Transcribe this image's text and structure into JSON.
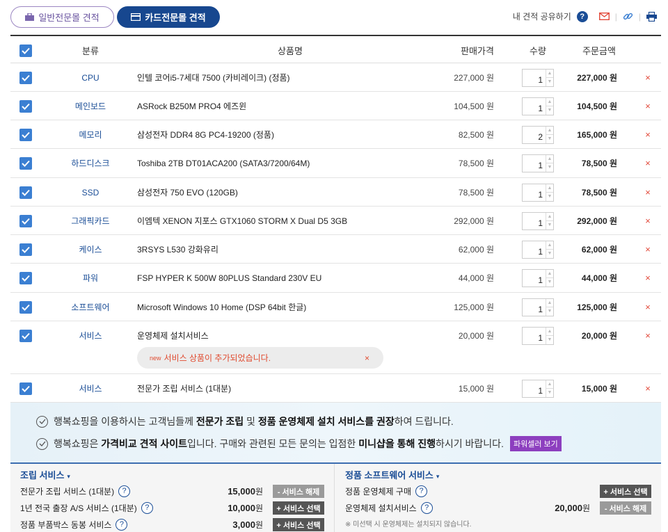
{
  "tabs": {
    "general": "일반전문몰 견적",
    "card": "카드전문몰 견적"
  },
  "share": {
    "label": "내 견적 공유하기",
    "help": "?"
  },
  "table": {
    "headers": {
      "category": "분류",
      "name": "상품명",
      "price": "판매가격",
      "qty": "수량",
      "total": "주문금액"
    },
    "rows": [
      {
        "category": "CPU",
        "name": "인텔 코어i5-7세대 7500 (카비레이크) (정품)",
        "price": "227,000 원",
        "qty": "1",
        "total": "227,000 원"
      },
      {
        "category": "메인보드",
        "name": "ASRock B250M PRO4 에즈윈",
        "price": "104,500 원",
        "qty": "1",
        "total": "104,500 원"
      },
      {
        "category": "메모리",
        "name": "삼성전자 DDR4 8G PC4-19200 (정품)",
        "price": "82,500 원",
        "qty": "2",
        "total": "165,000 원"
      },
      {
        "category": "하드디스크",
        "name": "Toshiba 2TB DT01ACA200 (SATA3/7200/64M)",
        "price": "78,500 원",
        "qty": "1",
        "total": "78,500 원"
      },
      {
        "category": "SSD",
        "name": "삼성전자 750 EVO (120GB)",
        "price": "78,500 원",
        "qty": "1",
        "total": "78,500 원"
      },
      {
        "category": "그래픽카드",
        "name": "이엠텍 XENON 지포스 GTX1060 STORM X Dual D5 3GB",
        "price": "292,000 원",
        "qty": "1",
        "total": "292,000 원"
      },
      {
        "category": "케이스",
        "name": "3RSYS L530 강화유리",
        "price": "62,000 원",
        "qty": "1",
        "total": "62,000 원"
      },
      {
        "category": "파워",
        "name": "FSP HYPER K 500W 80PLUS Standard 230V EU",
        "price": "44,000 원",
        "qty": "1",
        "total": "44,000 원"
      },
      {
        "category": "소프트웨어",
        "name": "Microsoft Windows 10 Home (DSP 64bit 한글)",
        "price": "125,000 원",
        "qty": "1",
        "total": "125,000 원"
      },
      {
        "category": "서비스",
        "name": "운영체제 설치서비스",
        "price": "20,000 원",
        "qty": "1",
        "total": "20,000 원"
      },
      {
        "category": "서비스",
        "name": "전문가 조립 서비스 (1대분)",
        "price": "15,000 원",
        "qty": "1",
        "total": "15,000 원"
      }
    ],
    "delete_symbol": "×",
    "notice": {
      "badge": "new",
      "text": "서비스 상품이 추가되었습니다.",
      "close": "×"
    }
  },
  "info": {
    "line1": {
      "a": "행복쇼핑을 이용하시는 고객님들께 ",
      "b": "전문가 조립",
      "c": " 및 ",
      "d": "정품 운영체제 설치 서비스를 권장",
      "e": "하여 드립니다."
    },
    "line2": {
      "a": "행복쇼핑은 ",
      "b": "가격비교 견적 사이트",
      "c": "입니다. 구매와 관련된 모든 문의는 입점한 ",
      "d": "미니샵을 통해 진행",
      "e": "하시기 바랍니다.",
      "button": "파워셀러 보기"
    }
  },
  "services": {
    "assembly": {
      "title": "조립 서비스",
      "items": [
        {
          "label": "전문가 조립 서비스 (1대분)",
          "price": "15,000",
          "unit": "원",
          "button": "- 서비스 해제",
          "selected": true
        },
        {
          "label": "1년 전국 출장 A/S 서비스 (1대분)",
          "price": "10,000",
          "unit": "원",
          "button": "+ 서비스 선택",
          "selected": false
        },
        {
          "label": "정품 부품박스 동봉 서비스",
          "price": "3,000",
          "unit": "원",
          "button": "+ 서비스 선택",
          "selected": false
        }
      ]
    },
    "software": {
      "title": "정품 소프트웨어 서비스",
      "items": [
        {
          "label": "정품 운영체제 구매",
          "button": "+ 서비스 선택",
          "selected": false
        },
        {
          "label": "운영체제 설치서비스",
          "price": "20,000",
          "unit": "원",
          "button": "- 서비스 해제",
          "selected": true
        }
      ],
      "note": "※ 미선택 시 운영체제는 설치되지 않습니다."
    }
  },
  "colors": {
    "primary": "#17478f",
    "checkbox": "#3b7fd2",
    "delete": "#e24a3b",
    "seller_button": "#8d3fbf"
  }
}
